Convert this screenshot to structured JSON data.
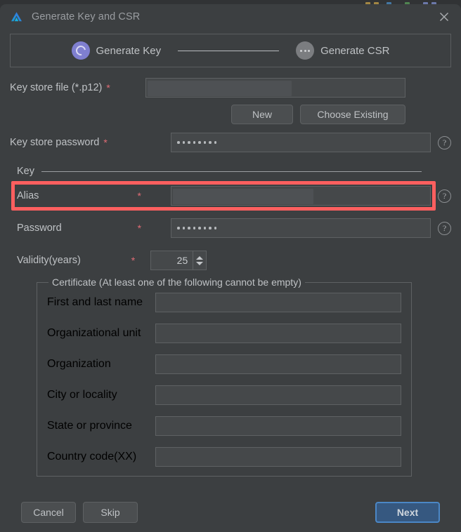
{
  "window": {
    "title": "Generate Key and CSR",
    "logo_icon": "deveco-logo-icon",
    "close_icon": "close-icon"
  },
  "stepper": {
    "steps": [
      {
        "label": "Generate Key",
        "state": "active",
        "icon": "progress-arc-icon"
      },
      {
        "label": "Generate CSR",
        "state": "inactive",
        "icon": "ellipsis-dots-icon"
      }
    ]
  },
  "keystore": {
    "file_label": "Key store file (*.p12)",
    "file_required": "*",
    "file_value": "",
    "file_placeholder": "",
    "new_button": "New",
    "choose_existing_button": "Choose Existing",
    "password_label": "Key store password",
    "password_required": "*",
    "password_value": "••••••••",
    "password_dot_count": 8,
    "help_icon": "help-circle-icon"
  },
  "key_section": {
    "title": "Key",
    "alias_label": "Alias",
    "alias_required": "*",
    "alias_value": "",
    "password_label": "Password",
    "password_required": "*",
    "password_dot_count": 8,
    "validity_label": "Validity(years)",
    "validity_required": "*",
    "validity_value": "25",
    "spinner_up_icon": "triangle-up-icon",
    "spinner_down_icon": "triangle-down-icon"
  },
  "certificate": {
    "legend": "Certificate (At least one of the following cannot be empty)",
    "fields": [
      {
        "label": "First and last name",
        "value": ""
      },
      {
        "label": "Organizational unit",
        "value": ""
      },
      {
        "label": "Organization",
        "value": ""
      },
      {
        "label": "City or locality",
        "value": ""
      },
      {
        "label": "State or province",
        "value": ""
      },
      {
        "label": "Country code(XX)",
        "value": ""
      }
    ]
  },
  "footer": {
    "cancel_label": "Cancel",
    "skip_label": "Skip",
    "next_label": "Next"
  },
  "annotation": {
    "target": "alias-row",
    "color": "#ff5f5f"
  },
  "colors": {
    "dialog_background": "#3c3f41",
    "field_background": "#45484a",
    "field_border": "#5e6163",
    "text": "#bfc2c5",
    "required_asterisk": "#e06c75",
    "step_active": "#7f7fd0",
    "step_inactive": "#7b7d80",
    "primary_button": "#365880",
    "primary_button_border": "#4b87c6",
    "highlight": "#ff5f5f"
  }
}
